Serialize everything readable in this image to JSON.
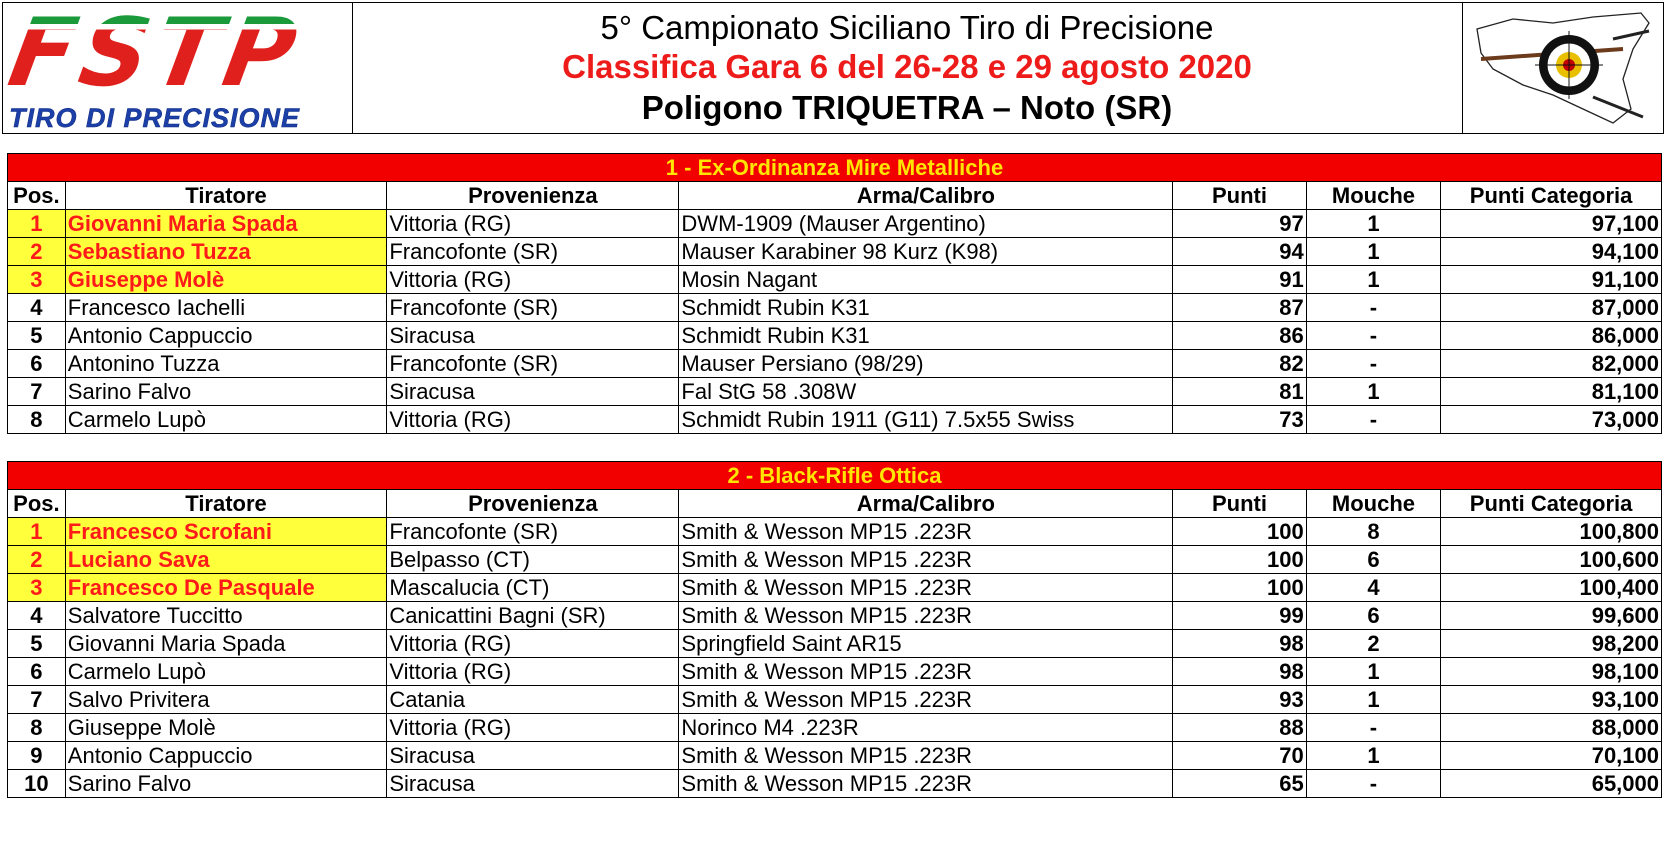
{
  "header": {
    "logo_text": "FSTP",
    "logo_subtitle": "TIRO DI PRECISIONE",
    "title_line1": "5° Campionato Siciliano Tiro di Precisione",
    "title_line2": "Classifica Gara 6 del 26-28 e 29 agosto 2020",
    "title_line3": "Poligono TRIQUETRA – Noto (SR)"
  },
  "columns": [
    "Pos.",
    "Tiratore",
    "Provenienza",
    "Arma/Calibro",
    "Punti",
    "Mouche",
    "Punti Categoria"
  ],
  "categories": [
    {
      "title": "1 - Ex-Ordinanza Mire Metalliche",
      "rows": [
        {
          "pos": "1",
          "name": "Giovanni Maria Spada",
          "origin": "Vittoria (RG)",
          "weapon": "DWM-1909 (Mauser Argentino)",
          "points": "97",
          "mouche": "1",
          "cat_points": "97,100"
        },
        {
          "pos": "2",
          "name": "Sebastiano Tuzza",
          "origin": "Francofonte (SR)",
          "weapon": "Mauser Karabiner 98 Kurz (K98)",
          "points": "94",
          "mouche": "1",
          "cat_points": "94,100"
        },
        {
          "pos": "3",
          "name": "Giuseppe Molè",
          "origin": "Vittoria (RG)",
          "weapon": "Mosin Nagant",
          "points": "91",
          "mouche": "1",
          "cat_points": "91,100"
        },
        {
          "pos": "4",
          "name": "Francesco Iachelli",
          "origin": "Francofonte (SR)",
          "weapon": "Schmidt Rubin K31",
          "points": "87",
          "mouche": "-",
          "cat_points": "87,000"
        },
        {
          "pos": "5",
          "name": "Antonio Cappuccio",
          "origin": "Siracusa",
          "weapon": "Schmidt Rubin K31",
          "points": "86",
          "mouche": "-",
          "cat_points": "86,000"
        },
        {
          "pos": "6",
          "name": "Antonino Tuzza",
          "origin": "Francofonte (SR)",
          "weapon": "Mauser Persiano (98/29)",
          "points": "82",
          "mouche": "-",
          "cat_points": "82,000"
        },
        {
          "pos": "7",
          "name": "Sarino Falvo",
          "origin": "Siracusa",
          "weapon": "Fal StG 58 .308W",
          "points": "81",
          "mouche": "1",
          "cat_points": "81,100"
        },
        {
          "pos": "8",
          "name": "Carmelo Lupò",
          "origin": "Vittoria (RG)",
          "weapon": "Schmidt Rubin 1911 (G11) 7.5x55 Swiss",
          "points": "73",
          "mouche": "-",
          "cat_points": "73,000"
        }
      ]
    },
    {
      "title": "2 - Black-Rifle Ottica",
      "rows": [
        {
          "pos": "1",
          "name": "Francesco Scrofani",
          "origin": "Francofonte (SR)",
          "weapon": "Smith & Wesson MP15 .223R",
          "points": "100",
          "mouche": "8",
          "cat_points": "100,800"
        },
        {
          "pos": "2",
          "name": "Luciano Sava",
          "origin": "Belpasso (CT)",
          "weapon": "Smith & Wesson MP15 .223R",
          "points": "100",
          "mouche": "6",
          "cat_points": "100,600"
        },
        {
          "pos": "3",
          "name": "Francesco De Pasquale",
          "origin": "Mascalucia (CT)",
          "weapon": "Smith & Wesson MP15 .223R",
          "points": "100",
          "mouche": "4",
          "cat_points": "100,400"
        },
        {
          "pos": "4",
          "name": "Salvatore Tuccitto",
          "origin": "Canicattini Bagni (SR)",
          "weapon": "Smith & Wesson MP15 .223R",
          "points": "99",
          "mouche": "6",
          "cat_points": "99,600"
        },
        {
          "pos": "5",
          "name": "Giovanni Maria Spada",
          "origin": "Vittoria (RG)",
          "weapon": "Springfield Saint AR15",
          "points": "98",
          "mouche": "2",
          "cat_points": "98,200"
        },
        {
          "pos": "6",
          "name": "Carmelo Lupò",
          "origin": "Vittoria (RG)",
          "weapon": "Smith & Wesson MP15 .223R",
          "points": "98",
          "mouche": "1",
          "cat_points": "98,100"
        },
        {
          "pos": "7",
          "name": "Salvo Privitera",
          "origin": "Catania",
          "weapon": "Smith & Wesson MP15 .223R",
          "points": "93",
          "mouche": "1",
          "cat_points": "93,100"
        },
        {
          "pos": "8",
          "name": "Giuseppe Molè",
          "origin": "Vittoria (RG)",
          "weapon": "Norinco M4 .223R",
          "points": "88",
          "mouche": "-",
          "cat_points": "88,000"
        },
        {
          "pos": "9",
          "name": "Antonio Cappuccio",
          "origin": "Siracusa",
          "weapon": "Smith & Wesson MP15 .223R",
          "points": "70",
          "mouche": "1",
          "cat_points": "70,100"
        },
        {
          "pos": "10",
          "name": "Sarino Falvo",
          "origin": "Siracusa",
          "weapon": "Smith & Wesson MP15 .223R",
          "points": "65",
          "mouche": "-",
          "cat_points": "65,000"
        }
      ]
    }
  ],
  "colors": {
    "category_bar": "#f20000",
    "category_text": "#ffe600",
    "podium_fill": "#ffff3c",
    "podium_text": "#ff1a1a"
  },
  "icons": [
    "fstp-logo",
    "sicily-target-emblem"
  ]
}
